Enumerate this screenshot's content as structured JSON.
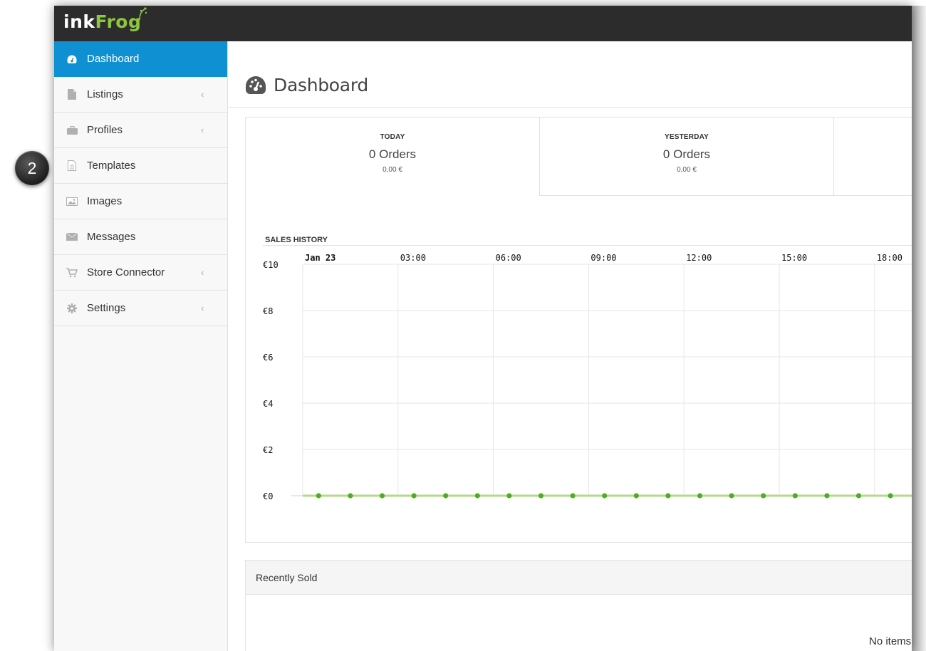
{
  "app": {
    "logo_ink": "ink",
    "logo_frog": "Frog"
  },
  "step_badge": "2",
  "sidebar": {
    "items": [
      {
        "label": "Dashboard",
        "icon": "dashboard-icon",
        "active": true,
        "chevron": false
      },
      {
        "label": "Listings",
        "icon": "file-icon",
        "active": false,
        "chevron": true
      },
      {
        "label": "Profiles",
        "icon": "briefcase-icon",
        "active": false,
        "chevron": true
      },
      {
        "label": "Templates",
        "icon": "file-text-icon",
        "active": false,
        "chevron": false
      },
      {
        "label": "Images",
        "icon": "image-icon",
        "active": false,
        "chevron": false
      },
      {
        "label": "Messages",
        "icon": "envelope-icon",
        "active": false,
        "chevron": false
      },
      {
        "label": "Store Connector",
        "icon": "cart-icon",
        "active": false,
        "chevron": true
      },
      {
        "label": "Settings",
        "icon": "gear-icon",
        "active": false,
        "chevron": true
      }
    ],
    "chevron_glyph": "‹"
  },
  "page": {
    "title": "Dashboard"
  },
  "stats": [
    {
      "label": "TODAY",
      "orders": "0 Orders",
      "amount": "0,00 €"
    },
    {
      "label": "YESTERDAY",
      "orders": "0 Orders",
      "amount": "0,00 €"
    }
  ],
  "sales_history": {
    "title": "SALES HISTORY"
  },
  "chart_data": {
    "type": "line",
    "title": "SALES HISTORY",
    "x_tick_labels": [
      "Jan 23",
      "03:00",
      "06:00",
      "09:00",
      "12:00",
      "15:00",
      "18:00"
    ],
    "y_tick_labels": [
      "€10",
      "€8",
      "€6",
      "€4",
      "€2",
      "€0"
    ],
    "ylim": [
      0,
      10
    ],
    "x_hours": [
      0.5,
      1.5,
      2.5,
      3.5,
      4.5,
      5.5,
      6.5,
      7.5,
      8.5,
      9.5,
      10.5,
      11.5,
      12.5,
      13.5,
      14.5,
      15.5,
      16.5,
      17.5,
      18.5
    ],
    "values": [
      0,
      0,
      0,
      0,
      0,
      0,
      0,
      0,
      0,
      0,
      0,
      0,
      0,
      0,
      0,
      0,
      0,
      0,
      0
    ],
    "line_color": "#b5d98a",
    "point_color": "#4caf1f",
    "grid": true
  },
  "recently_sold": {
    "title": "Recently Sold",
    "empty_text": "No items"
  },
  "colors": {
    "accent": "#0e90d2",
    "topbar": "#2c2c2c",
    "brand_green": "#8dc63f"
  }
}
